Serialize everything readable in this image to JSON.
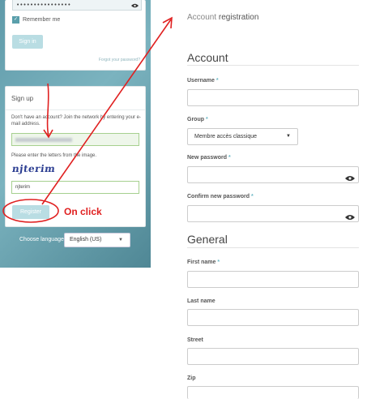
{
  "login": {
    "password_value": "••••••••••••••••",
    "remember_label": "Remember me",
    "signin_label": "Sign in",
    "forgot_label": "Forgot your password?"
  },
  "signup": {
    "title": "Sign up",
    "description": "Don't have an account? Join the network by entering your e-mail address.",
    "captcha_label": "Please enter the letters from the image.",
    "captcha_image_text": "njterim",
    "captcha_value": "njterim",
    "register_label": "Register"
  },
  "language": {
    "label": "Choose language:",
    "selected": "English (US)"
  },
  "annotation": {
    "text": "On click",
    "color": "#e02020"
  },
  "form": {
    "title_strong": "Account",
    "title_rest": " registration",
    "sections": {
      "account": "Account",
      "general": "General"
    },
    "fields": {
      "username": "Username",
      "group": "Group",
      "group_value": "Membre accès classique",
      "new_password": "New password",
      "confirm_password": "Confirm new password",
      "first_name": "First name",
      "last_name": "Last name",
      "street": "Street",
      "zip": "Zip"
    },
    "required_marker": "*"
  },
  "colors": {
    "accent": "#5a9fab",
    "button": "#b9dde3",
    "panel_bg": "#6aa5b2"
  }
}
